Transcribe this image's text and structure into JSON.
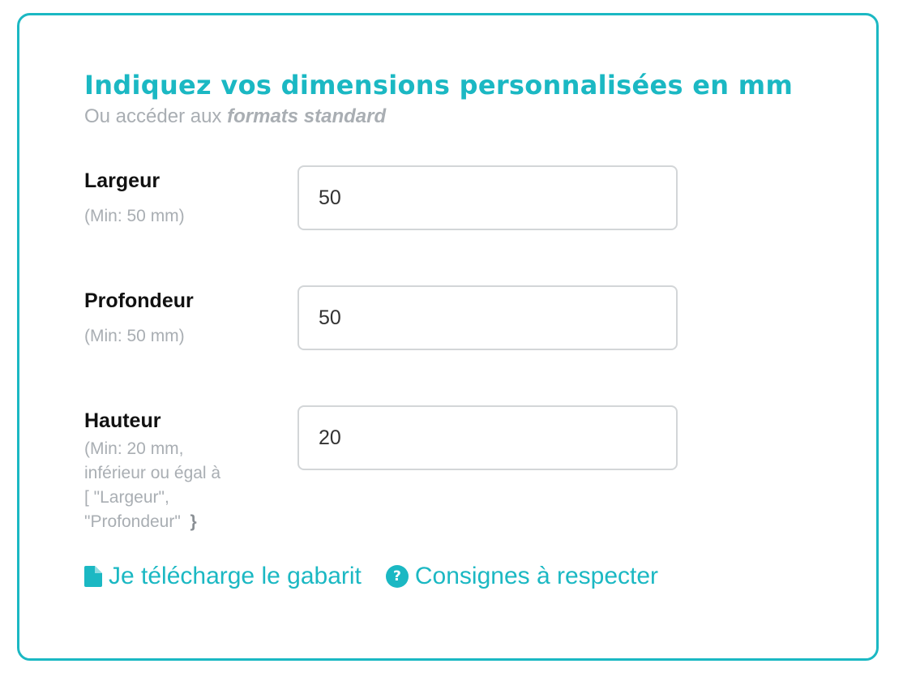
{
  "heading": {
    "title": "Indiquez vos dimensions personnalisées en mm",
    "subtitle_prefix": "Ou accéder aux",
    "subtitle_link": "formats standard"
  },
  "fields": [
    {
      "label": "Largeur",
      "hint_lines": [
        "(Min: 50 mm)"
      ],
      "value": "50"
    },
    {
      "label": "Profondeur",
      "hint_lines": [
        "(Min: 50 mm)"
      ],
      "value": "50"
    },
    {
      "label": "Hauteur",
      "hint_lines": [
        "(Min: 20 mm,",
        "inférieur ou égal à",
        "[ \"Largeur\",",
        "\"Profondeur\""
      ],
      "hint_closing": "}",
      "value": "20"
    }
  ],
  "links": {
    "template": {
      "label": "Je télécharge le gabarit",
      "icon": "file-icon"
    },
    "guidelines": {
      "label": "Consignes à respecter",
      "icon": "question-circle-icon",
      "icon_glyph": "?"
    }
  },
  "colors": {
    "accent": "#1bb8c3",
    "muted_text": "#a9aeb3",
    "input_border": "#d3d6d8",
    "label_text": "#111111"
  }
}
